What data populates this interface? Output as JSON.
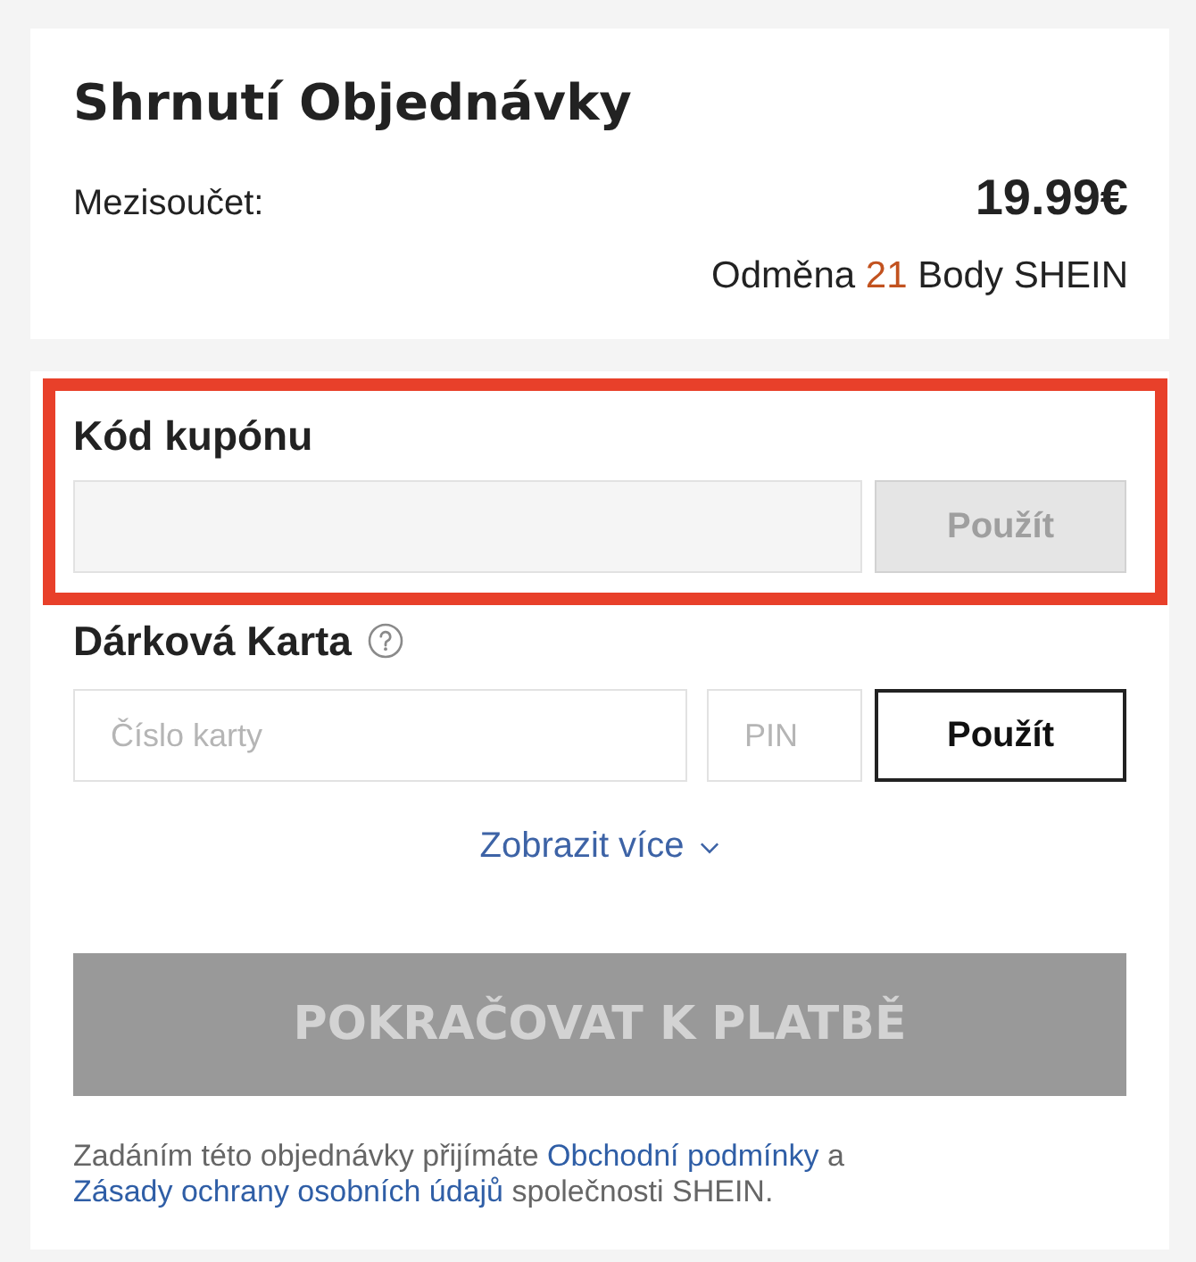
{
  "order_summary": {
    "title": "Shrnutí Objednávky",
    "subtotal": {
      "label": "Mezisoučet:",
      "value": "19.99€"
    },
    "reward": {
      "prefix": "Odměna",
      "points": "21",
      "suffix": "Body SHEIN"
    }
  },
  "coupon": {
    "label": "Kód kupónu",
    "highlighted": true,
    "apply_button": {
      "label": "Použít",
      "disabled": true
    }
  },
  "gift_card": {
    "label": "Dárková Karta",
    "card_number": {
      "placeholder": "Číslo karty"
    },
    "pin": {
      "placeholder": "PIN"
    },
    "apply_button": {
      "label": "Použít",
      "disabled": false
    }
  },
  "show_more": {
    "label": "Zobrazit více",
    "expanded": false
  },
  "checkout_button": {
    "label": "POKRAČOVAT K PLATBĚ",
    "disabled": true
  },
  "terms": [
    {
      "kind": "text",
      "text": "Zadáním této objednávky přijímáte"
    },
    {
      "kind": "link",
      "text": "Obchodní podmínky"
    },
    {
      "kind": "text",
      "text": "a"
    },
    {
      "kind": "link",
      "text": "Zásady ochrany osobních údajů"
    },
    {
      "kind": "text",
      "text": "společnosti SHEIN."
    }
  ]
}
